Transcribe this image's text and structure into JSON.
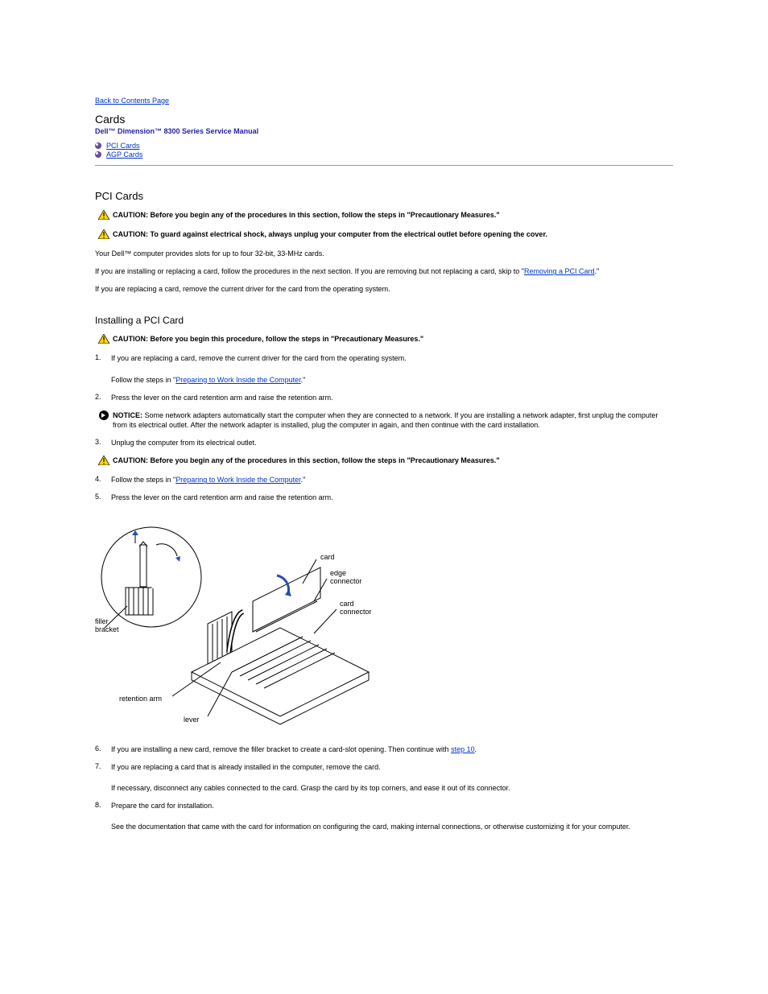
{
  "back_link": "Back to Contents Page",
  "title": "Cards",
  "manual_line": "Dell™ Dimension™ 8300 Series Service Manual",
  "toc": [
    "PCI Cards",
    "AGP Cards"
  ],
  "pci": {
    "heading": "PCI Cards",
    "caution1_label": "CAUTION: ",
    "caution1_text": "Before you begin any of the procedures in this section, follow the steps in \"Precautionary Measures.\"",
    "caution2_label": "CAUTION: ",
    "caution2_text": "To guard against electrical shock, always unplug your computer from the electrical outlet before opening the cover.",
    "intro_1": "Your Dell™ computer provides slots for up to four 32",
    "intro_1_rest": "-bit, 33-MHz cards.",
    "intro_2": "If you are installing or replacing a card, follow the procedures in the next section. If you are removing but not replacing a card, skip to \"",
    "intro_2_link": "Removing a PCI Card",
    "intro_2_end": ".\"",
    "intro_3": "If you are replacing a card, remove the current driver for the card from the operating system."
  },
  "install": {
    "heading": "Installing a PCI Card",
    "caution_label": "CAUTION: ",
    "caution_text": "Before you begin this procedure, follow the steps in \"Precautionary Measures.\"",
    "step1_num": "1.",
    "step1_a": "If you are replacing a card, remove the current driver for the card from the operating system.",
    "step1_b_pre": "Follow the steps in \"",
    "step1_b_link": "Preparing to Work Inside the Computer",
    "step1_b_post": ".\"",
    "step2_num": "2.",
    "step2": "Press the lever on the card retention arm and raise the retention arm.",
    "notice_label": "NOTICE: ",
    "notice_text": "Some network adapters automatically start the computer when they are connected to a network. If you are installing a network adapter, first unplug the computer from its electrical outlet. After the network adapter is installed, plug the computer in again, and then continue with the card installation.",
    "step3_num": "3.",
    "step3": "Unplug the computer from its electrical outlet.",
    "caution2_label": "CAUTION: ",
    "caution2_text": "Before you begin any of the procedures in this section, follow the steps in \"Precautionary Measures.\"",
    "step4_num": "4.",
    "step4_pre": "Follow the steps in \"",
    "step4_link": "Preparing to Work Inside the Computer",
    "step4_post": ".\"",
    "step5_num": "5.",
    "step5": "Press the lever on the card retention arm and raise the retention arm."
  },
  "figure": {
    "labels": {
      "filler_bracket": "filler\nbracket",
      "retention_arm": "retention arm",
      "lever": "lever",
      "card": "card",
      "edge_connector": "edge\nconnector",
      "card_connector": "card\nconnector"
    }
  },
  "after_fig": {
    "step6_num": "6.",
    "step6_a": "If you are installing a new card, remove the filler bracket to create a card-slot opening. Then continue with ",
    "step6_link": "step 10",
    "step6_post": ".",
    "step7_num": "7.",
    "step7": "If you are replacing a card that is already installed in the computer, remove the card.",
    "step7b": "If necessary, disconnect any cables connected to the card. Grasp the card by its top corners, and ease it out of its connector.",
    "step8_num": "8.",
    "step8": "Prepare the card for installation.",
    "step8b": "See the documentation that came with the card for information on configuring the card, making internal connections, or otherwise customizing it for your computer."
  }
}
